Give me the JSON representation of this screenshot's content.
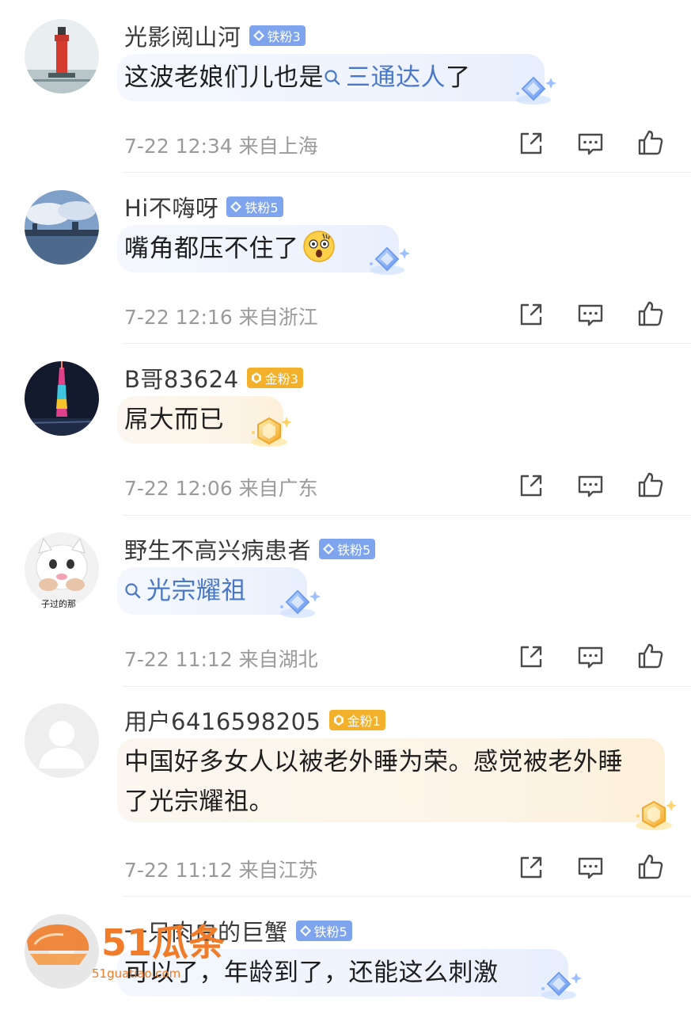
{
  "comments": [
    {
      "username": "光影阅山河",
      "badge": {
        "label": "铁粉3",
        "tier": "iron"
      },
      "text_plain": "这波老娘们儿也是",
      "topic": "三通达人",
      "text_after": "了",
      "meta": "7-22 12:34 来自上海",
      "avatar_icon": "lighthouse-avatar"
    },
    {
      "username": "Hi不嗨呀",
      "badge": {
        "label": "铁粉5",
        "tier": "iron"
      },
      "text_plain": "嘴角都压不住了",
      "emoji": "shocked-face-emoji",
      "meta": "7-22 12:16 来自浙江",
      "avatar_icon": "cityscape-avatar"
    },
    {
      "username": "B哥83624",
      "badge": {
        "label": "金粉3",
        "tier": "gold"
      },
      "text_plain": "屌大而已",
      "meta": "7-22 12:06 来自广东",
      "avatar_icon": "tower-night-avatar"
    },
    {
      "username": "野生不高兴病患者",
      "badge": {
        "label": "铁粉5",
        "tier": "iron"
      },
      "topic": "光宗耀祖",
      "meta": "7-22 11:12 来自湖北",
      "avatar_icon": "cat-avatar",
      "avatar_caption": "子过的那"
    },
    {
      "username": "用户6416598205",
      "badge": {
        "label": "金粉1",
        "tier": "gold"
      },
      "text_line1": "中国好多女人以被老外睡为荣。感觉被老外睡",
      "text_line2": "了光宗耀祖。",
      "meta": "7-22 11:12 来自江苏",
      "avatar_icon": "default-user-avatar"
    },
    {
      "username": "一只肉白的巨蟹",
      "badge": {
        "label": "铁粉5",
        "tier": "iron"
      },
      "text_plain": "可以了，年龄到了，还能这么刺激",
      "avatar_icon": "partial-avatar"
    }
  ],
  "actions": [
    "share-icon",
    "comment-icon",
    "like-icon"
  ],
  "watermark": {
    "logo_text": "51瓜条",
    "url": "51guatiao.com"
  },
  "colors": {
    "iron_badge": "#7fa4ee",
    "gold_badge": "#f2b02b",
    "topic_link": "#4a78c9",
    "meta_text": "#9a9a9a",
    "watermark": "#f07c2a"
  }
}
